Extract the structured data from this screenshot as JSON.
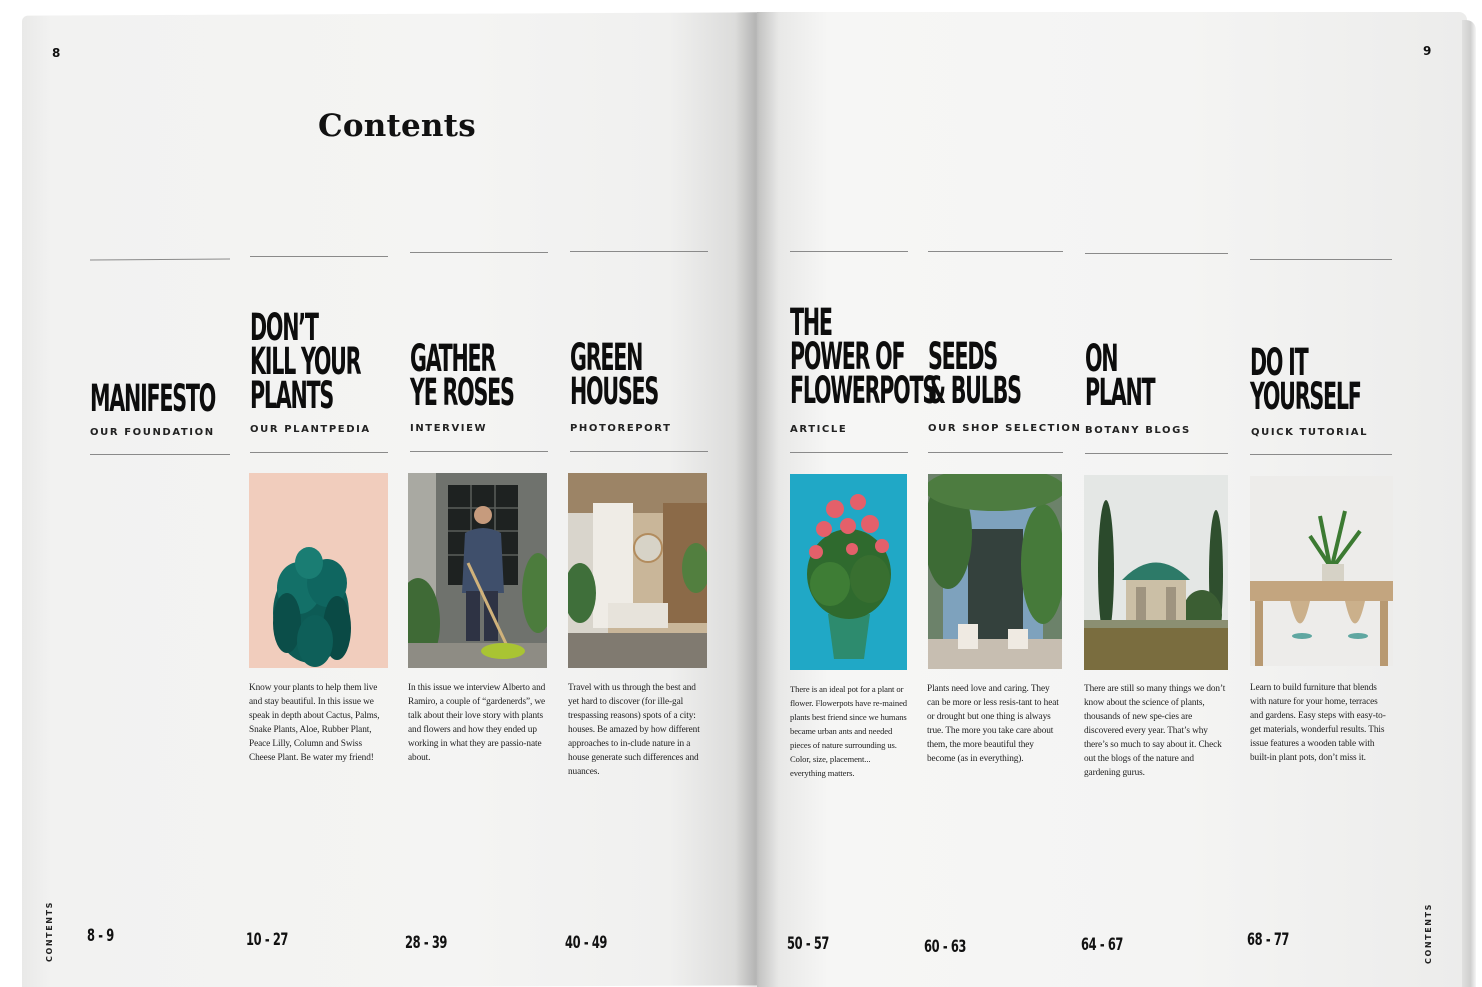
{
  "left_page": {
    "folio": "8",
    "title": "Contents",
    "side_label": "CONTENTS"
  },
  "right_page": {
    "folio": "9",
    "side_label": "CONTENTS"
  },
  "entries": [
    {
      "title": "MANIFESTO",
      "label": "OUR FOUNDATION",
      "text": "",
      "pages": "8 - 9",
      "icon": ""
    },
    {
      "title": "DON’T\nKILL YOUR\nPLANTS",
      "label": "OUR PLANTPEDIA",
      "text": "Know your plants to help them live and stay beautiful. In this issue we speak in depth about Cactus, Palms, Snake Plants, Aloe, Rubber Plant, Peace Lilly, Column and Swiss Cheese Plant. Be water my friend!",
      "pages": "10 - 27",
      "icon": "succulent-photo"
    },
    {
      "title": "GATHER\nYE ROSES",
      "label": "INTERVIEW",
      "text": "In this issue we interview Alberto and Ramiro, a couple of “gardenerds”, we talk about their love story with plants and flowers and how they ended up working in what they are passio-nate about.",
      "pages": "28 - 39",
      "icon": "gardener-photo"
    },
    {
      "title": "GREEN\nHOUSES",
      "label": "PHOTOREPORT",
      "text": "Travel with us through the best and yet hard to discover (for ille-gal trespassing reasons) spots of a city: houses. Be amazed by how different approaches to in-clude nature in a house generate such differences and nuances.",
      "pages": "40 - 49",
      "icon": "bathroom-photo"
    },
    {
      "title": "THE\nPOWER OF\nFLOWERPOTS",
      "label": "ARTICLE",
      "text": "There is an ideal pot for a plant or flower. Flowerpots have re-mained plants best friend since we humans became urban ants and needed pieces of nature surrounding us. Color, size, placement... everything matters.",
      "pages": "50 - 57",
      "icon": "begonia-photo"
    },
    {
      "title": "SEEDS\n& BULBS",
      "label": "OUR SHOP SELECTION",
      "text": "Plants need love and caring. They can be more or less resis-tant to heat or drought but one thing is always true. The more you take care about them, the more beautiful they become (as in everything).",
      "pages": "60 - 63",
      "icon": "shop-photo"
    },
    {
      "title": "ON\nPLANT",
      "label": "BOTANY BLOGS",
      "text": "There are still so many things we don’t know about the science of plants, thousands of new spe-cies are discovered every year. That’s why there’s so much to say about it. Check out the blogs of the nature and gardening gurus.",
      "pages": "64 - 67",
      "icon": "garden-pavilion-photo"
    },
    {
      "title": "DO IT\nYOURSELF",
      "label": "QUICK TUTORIAL",
      "text": "Learn to build furniture that blends with nature for your home, terraces and gardens. Easy steps with easy-to-get materials, wonderful results. This issue features a wooden table with built-in plant pots, don’t miss it.",
      "pages": "68 - 77",
      "icon": "diy-table-photo"
    }
  ]
}
